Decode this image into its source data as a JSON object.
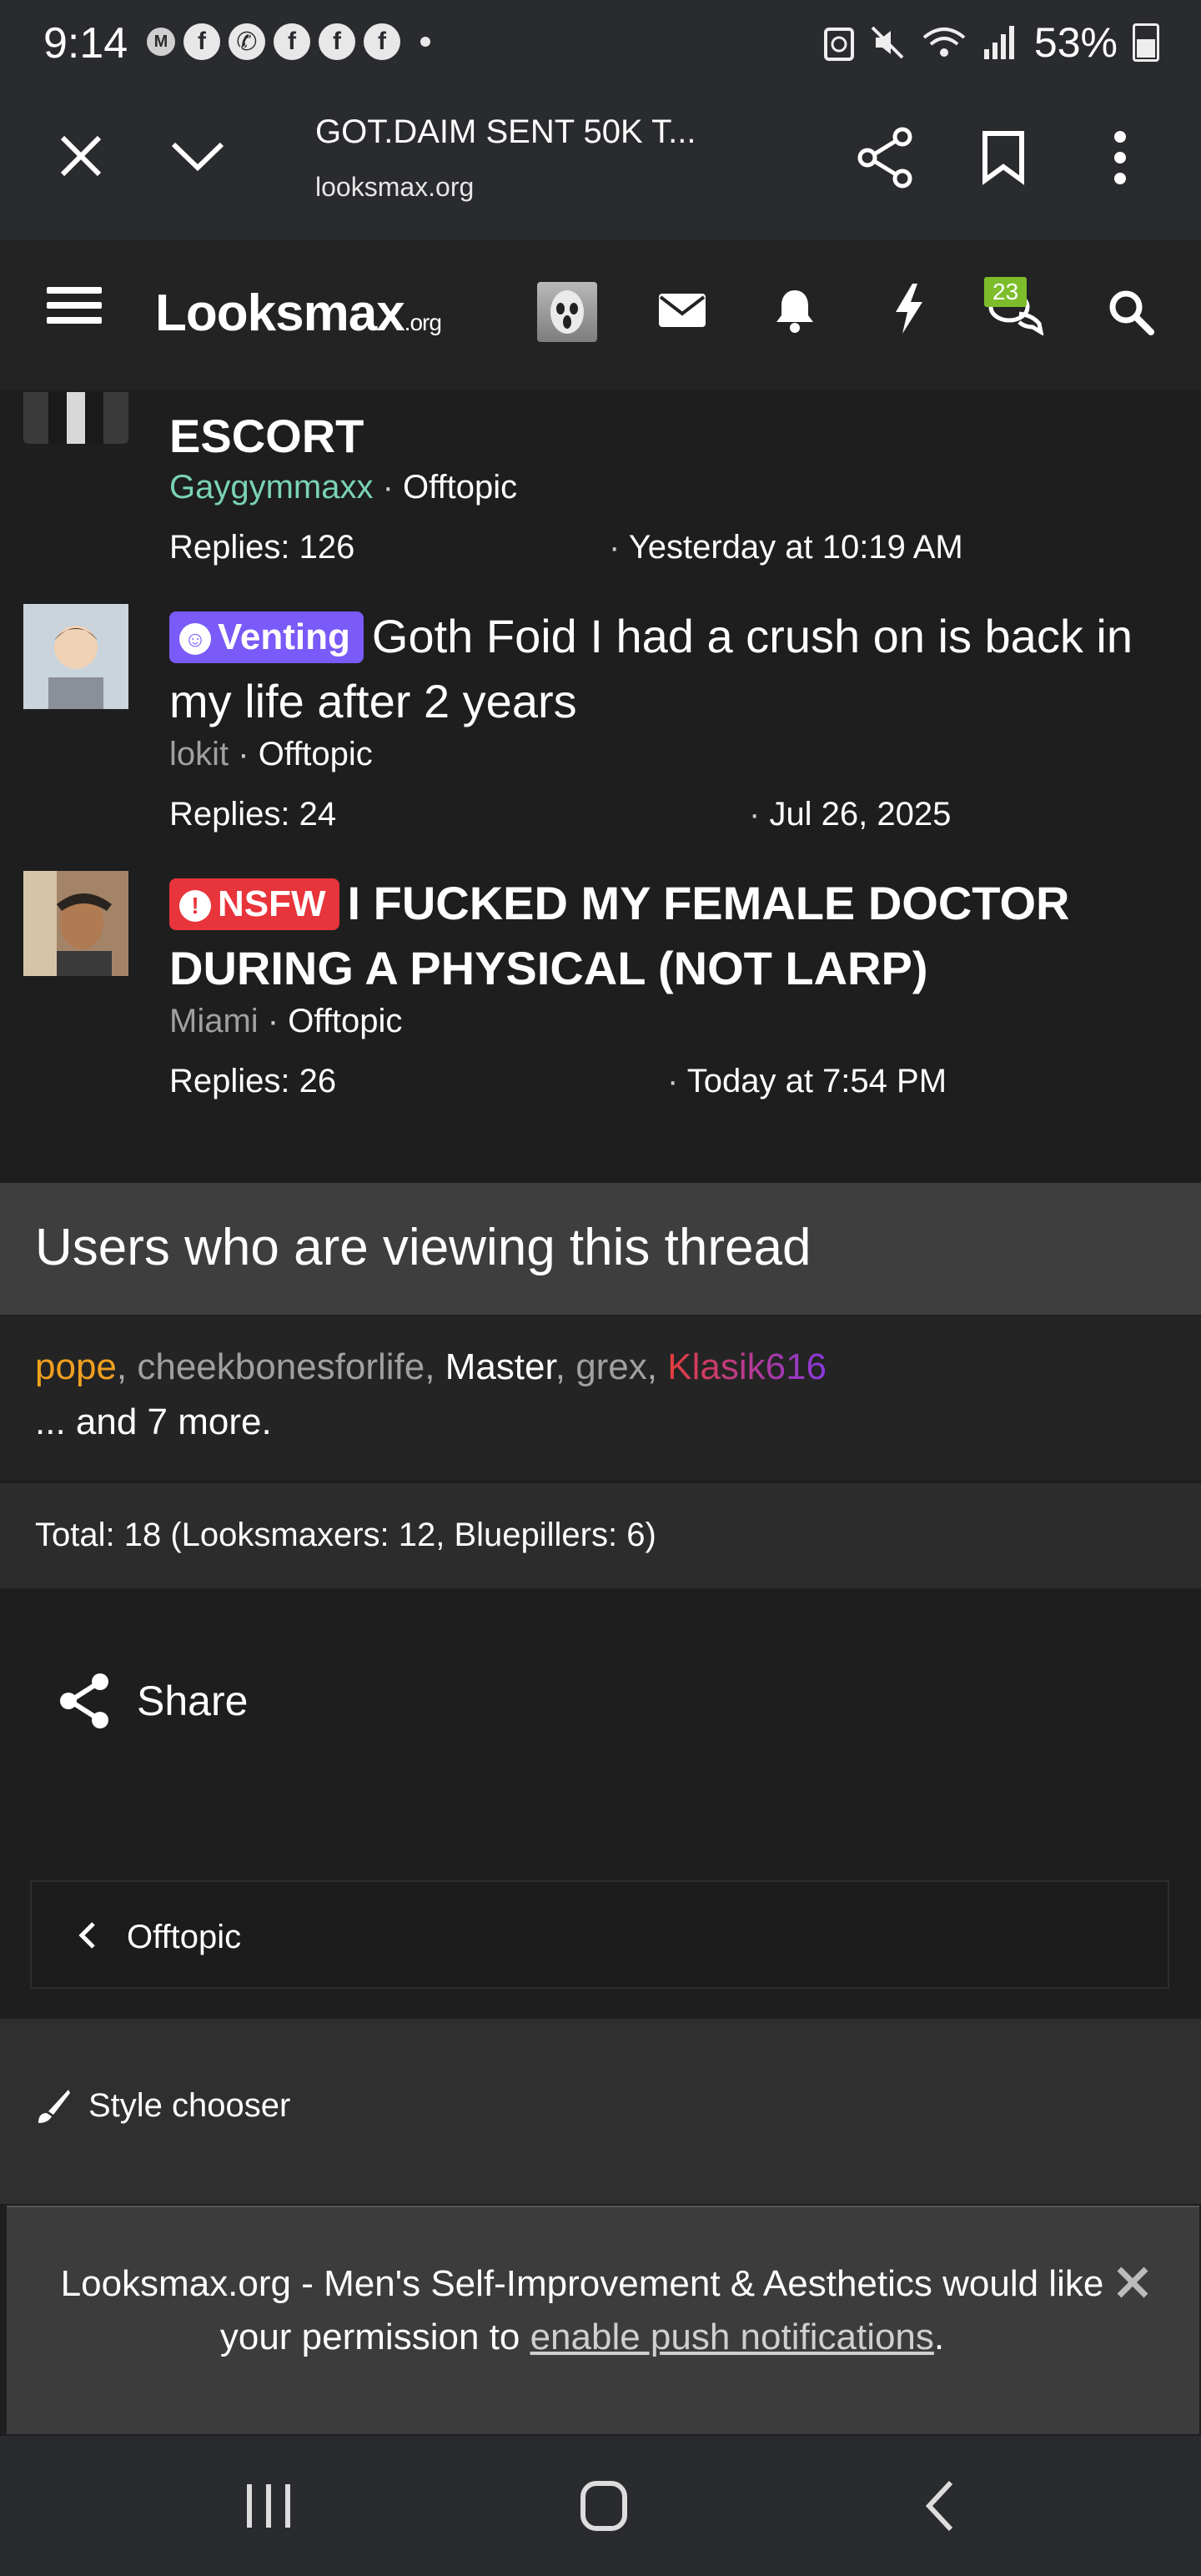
{
  "status_bar": {
    "time": "9:14",
    "notification_icons": [
      "m-icon",
      "facebook-icon",
      "whatsapp-icon",
      "facebook-icon",
      "facebook-icon",
      "facebook-icon"
    ],
    "battery": "53%"
  },
  "browser": {
    "page_title": "GOT.DAIM SENT 50K T...",
    "url": "looksmax.org"
  },
  "site_header": {
    "logo_main": "Looksmax",
    "logo_suffix": ".org",
    "chat_badge": "23"
  },
  "threads": [
    {
      "title": "ESCORT",
      "author": "Gaygymmaxx",
      "forum": "Offtopic",
      "replies": "Replies: 126",
      "date": "Yesterday at 10:19 AM"
    },
    {
      "prefix": "Venting",
      "title": "Goth Foid I had a crush on is back in my life after 2 years",
      "author": "lokit",
      "forum": "Offtopic",
      "replies": "Replies: 24",
      "date": "Jul 26, 2025"
    },
    {
      "prefix": "NSFW",
      "title": "I FUCKED MY FEMALE DOCTOR DURING A PHYSICAL (NOT LARP)",
      "author": "Miami",
      "forum": "Offtopic",
      "replies": "Replies: 26",
      "date": "Today at 7:54 PM"
    }
  ],
  "viewing": {
    "heading": "Users who are viewing this thread",
    "users": [
      "pope",
      "cheekbonesforlife",
      "Master",
      "grex",
      "Klasik616"
    ],
    "more": "... and 7 more.",
    "total": "Total: 18 (Looksmaxers: 12, Bluepillers: 6)"
  },
  "share_label": "Share",
  "breadcrumb": "Offtopic",
  "footer": {
    "style_chooser": "Style chooser"
  },
  "push_prompt": {
    "text_before": "Looksmax.org - Men's Self-Improvement & Aesthetics would like your permission to ",
    "link": "enable push notifications",
    "text_after": "."
  },
  "colors": {
    "author_green": "#7ad3b4",
    "user_orange": "#f0a020",
    "user_gray": "#a0a0a0",
    "user_white": "#ffffff",
    "user_red": "#e43d3d",
    "venting_purple": "#7a5af8",
    "nsfw_red": "#e8343b"
  }
}
